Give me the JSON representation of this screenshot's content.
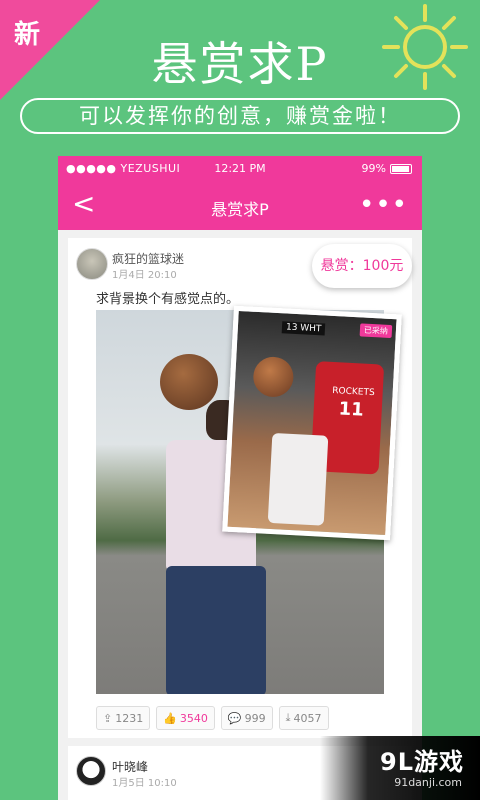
{
  "promo": {
    "badge": "新",
    "title": "悬赏求P",
    "subtitle": "可以发挥你的创意，赚赏金啦！"
  },
  "status_bar": {
    "carrier": "●●●●● YEZUSHUI",
    "time": "12:21 PM",
    "battery": "99%"
  },
  "nav": {
    "back": "<",
    "title": "悬赏求P",
    "more": "•••"
  },
  "post": {
    "username": "疯狂的篮球迷",
    "date": "1月4日  20:10",
    "reward": "悬赏：100元",
    "text": "求背景换个有感觉点的。",
    "overlay_tag": "已采纳",
    "overlay_score": "13   WHT",
    "overlay_jersey": "ROCKETS",
    "overlay_number": "11",
    "actions": {
      "share": "1231",
      "like": "3540",
      "comment": "999",
      "download": "4057"
    }
  },
  "post2": {
    "username": "叶晓峰",
    "date": "1月5日  10:10"
  },
  "watermark": {
    "brand": "9L游戏",
    "url": "91danji.com"
  },
  "colors": {
    "background": "#5cc47e",
    "accent": "#f0399b"
  }
}
